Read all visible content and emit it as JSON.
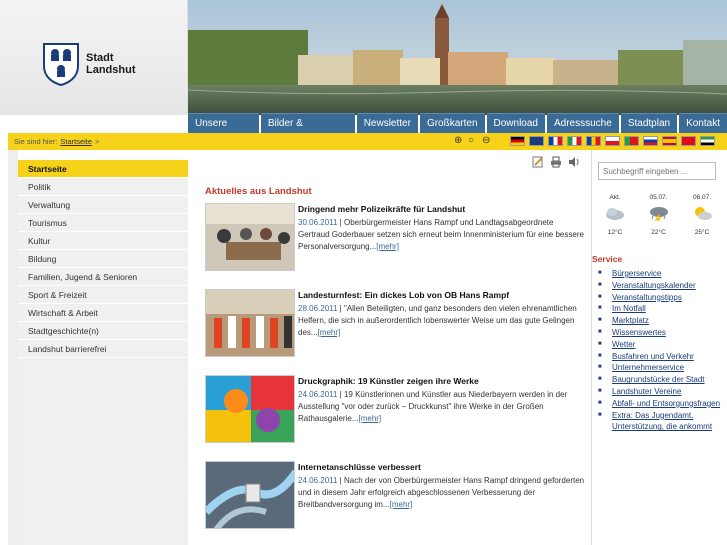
{
  "header": {
    "logo_line1": "Stadt",
    "logo_line2": "Landshut"
  },
  "nav": [
    "Unsere Stadt",
    "Bilder & Webcams",
    "Newsletter",
    "Großkarten",
    "Download",
    "Adresssuche",
    "Stadtplan",
    "Kontakt"
  ],
  "breadcrumb": {
    "prefix": "Sie sind hier:",
    "current": "Startseite",
    "arrow": ">"
  },
  "flags": [
    "Deutsch",
    "English",
    "Français",
    "Italiano",
    "Română",
    "Polski",
    "Português",
    "Русский",
    "Español",
    "Türkçe",
    "العربية"
  ],
  "sidebar": {
    "items": [
      "Startseite",
      "Politik",
      "Verwaltung",
      "Tourismus",
      "Kultur",
      "Bildung",
      "Familien, Jugend & Senioren",
      "Sport & Freizeit",
      "Wirtschaft & Arbeit",
      "Stadtgeschichte(n)",
      "Landshut barrierefrei"
    ]
  },
  "main": {
    "heading": "Aktuelles aus Landshut",
    "more_label": "[mehr]",
    "news": [
      {
        "title": "Dringend mehr Polizeikräfte für Landshut",
        "date": "30.06.2011",
        "text": " | Oberbürgermeister Hans Rampf und Landtagsabgeordnete Gertraud Goderbauer setzen sich erneut beim Innenministerium für eine bessere Personalversorgung..."
      },
      {
        "title": "Landesturnfest: Ein dickes Lob von OB Hans Rampf",
        "date": "28.06.2011",
        "text": " | \"Allen Beteiligten, und ganz besonders den vielen ehrenamtlichen Helfern, die sich in außerordentlich lobenswerter Weise um das gute Gelingen des..."
      },
      {
        "title": "Druckgraphik: 19 Künstler zeigen ihre Werke",
        "date": "24.06.2011",
        "text": " | 19 Künstlerinnen und Künstler aus Niederbayern werden in der Ausstellung \"vor oder zurück – Druckkunst\" ihre Werke in der Großen Rathausgalerie..."
      },
      {
        "title": "Internetanschlüsse verbessert",
        "date": "24.06.2011",
        "text": " | Nach der von Oberbürgermeister Hans Rampf dringend geforderten und in diesem Jahr erfolgreich abgeschlossenen Verbesserung der Breitbandversorgung im..."
      }
    ]
  },
  "search": {
    "placeholder": "Suchbegriff eingeben ..."
  },
  "weather": [
    {
      "day": "Akt.",
      "temp": "12°C",
      "icon": "cloud-icon"
    },
    {
      "day": "05.07.",
      "temp": "22°C",
      "icon": "storm-cloud-icon"
    },
    {
      "day": "06.07.",
      "temp": "25°C",
      "icon": "sun-cloud-icon"
    }
  ],
  "service": {
    "title": "Service",
    "items": [
      "Bürgerservice",
      "Veranstaltungskalender",
      "Veranstaltungstipps",
      "Im Notfall",
      "Marktplatz",
      "Wissenswertes",
      "Wetter",
      "Busfahren und Verkehr",
      "Unternehmerservice",
      "Baugrundstücke der Stadt",
      "Landshuter Vereine",
      "Abfall- und Entsorgungsfragen",
      "Extra: Das Jugendamt. Unterstützung, die ankommt"
    ]
  },
  "colors": {
    "accent_yellow": "#f7d21a",
    "nav_blue": "#3a6a96",
    "heading_red": "#c0392b"
  }
}
